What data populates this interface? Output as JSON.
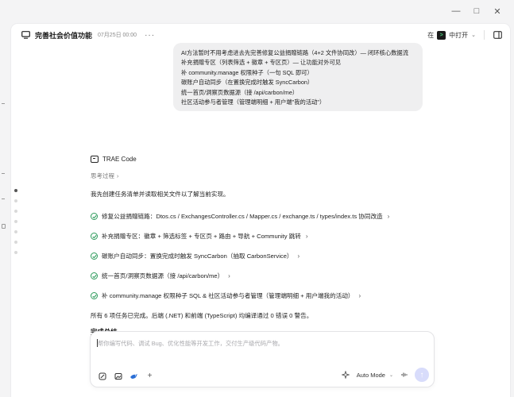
{
  "window": {
    "minimize": "—",
    "maximize": "□",
    "close": "✕"
  },
  "header": {
    "title": "完善社会价值功能",
    "time": "07月25日 00:00",
    "more": "···",
    "open_in_prefix": "在",
    "open_in_label": "中打开",
    "open_in_chevron": "⌄"
  },
  "user_message": {
    "lines": [
      "AI方法暂时不用考虑进去先完善修复公益捐赠链路（4+2 文件协同改）— 闭环核心数据流",
      "补充捐赠专区（列表筛选 + 徽章 + 专区页）— 让功能对外可见",
      "补 community.manage 权限种子（一句 SQL 即可）",
      "碳账户自动同步（在置换完成时触发 SyncCarbon）",
      "统一首页/洞察页数据源（接 /api/carbon/me）",
      "社区活动参与者管理（管理端明细 + 用户端\"我的活动\"）"
    ]
  },
  "agent": {
    "name": "TRAE Code",
    "thinking_label": "思考过程",
    "thinking_chevron": "›",
    "intro": "我先创建任务清单并读取相关文件以了解当前实现。",
    "tasks": [
      "修复公益捐赠链路：Dtos.cs / ExchangesController.cs / Mapper.cs / exchange.ts / types/index.ts 协同改造",
      "补充捐赠专区：徽章 + 筛选标签 + 专区页 + 路由 + 导航 + Community 跳转",
      "碳账户自动同步：置换完成时触发 SyncCarbon（抽取 CarbonService）",
      "统一首页/洞察页数据源（接 /api/carbon/me）",
      "补 community.manage 权限种子 SQL & 社区活动参与者管理（管理端明细 + 用户端我的活动）"
    ],
    "task_arrow": "›",
    "summary": "所有 6 项任务已完成。后端 (.NET) 和前端 (TypeScript) 均编译通过 0 错误 0 警告。",
    "section_title": "完成总结"
  },
  "composer": {
    "placeholder": "帮你编写代码、调试 Bug、优化性能等开发工作，交付生产级代码产物。",
    "add": "+",
    "mode_label": "Auto Mode",
    "mode_chevron": "⌄",
    "send": "↑"
  },
  "colors": {
    "check": "#2e9b5c",
    "send_button": "#d8dcfb",
    "bubble": "#efeff0"
  },
  "icons": [
    "monitor-icon",
    "panel-toggle-icon",
    "sparkle-icon",
    "mic-icon",
    "attach-icon",
    "image-icon",
    "bird-icon"
  ]
}
